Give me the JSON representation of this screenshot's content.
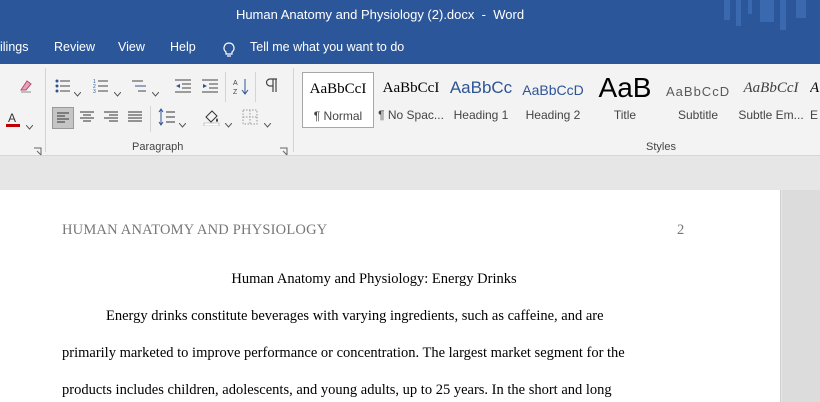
{
  "window": {
    "document_name": "Human Anatomy and Physiology (2).docx",
    "separator": "-",
    "app_name": "Word"
  },
  "menu": {
    "tabs": [
      "ilings",
      "Review",
      "View",
      "Help"
    ],
    "tell_me": "Tell me what you want to do"
  },
  "ribbon": {
    "paragraph_group_label": "Paragraph",
    "styles_group_label": "Styles",
    "styles": [
      {
        "sample": "AaBbCcI",
        "name": "¶ Normal"
      },
      {
        "sample": "AaBbCcI",
        "name": "¶ No Spac..."
      },
      {
        "sample": "AaBbCc",
        "name": "Heading 1"
      },
      {
        "sample": "AaBbCcD",
        "name": "Heading 2"
      },
      {
        "sample": "AaB",
        "name": "Title"
      },
      {
        "sample": "AaBbCcD",
        "name": "Subtitle"
      },
      {
        "sample": "AaBbCcI",
        "name": "Subtle Em..."
      },
      {
        "sample": "A",
        "name": "E"
      }
    ],
    "colors": {
      "accent_red": "#c00000",
      "heading_blue": "#2f5496"
    }
  },
  "document": {
    "running_head": "HUMAN ANATOMY AND PHYSIOLOGY",
    "page_number": "2",
    "title": "Human Anatomy and Physiology: Energy Drinks",
    "lines": [
      "Energy drinks constitute beverages with varying ingredients, such as caffeine, and are",
      "primarily marketed to improve performance or concentration. The largest market segment for the",
      "products includes children, adolescents, and young adults, up to 25 years. In the short and long"
    ]
  }
}
